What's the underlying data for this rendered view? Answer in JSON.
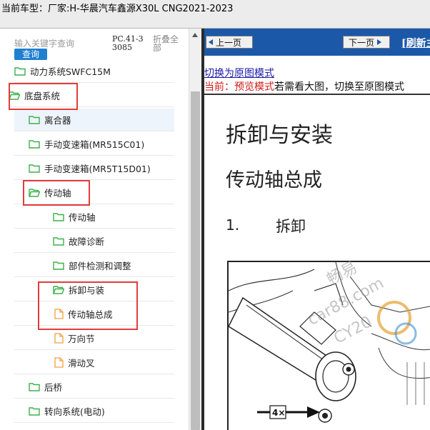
{
  "header": {
    "vehicle_label": "当前车型：厂家:H-华晨汽车鑫源X30L CNG2021-2023"
  },
  "sidebar": {
    "search_placeholder": "输入关键字查询",
    "query_label": "查询",
    "pc_code": "PC.41-33085",
    "collapse_label": "折叠全部",
    "items": [
      {
        "label": "动力系统SWFC15M",
        "icon": "folder-icon",
        "level": 0
      },
      {
        "label": "底盘系统",
        "icon": "folder-open-icon",
        "level": 0
      },
      {
        "label": "离合器",
        "icon": "folder-icon",
        "level": 1
      },
      {
        "label": "手动变速箱(MR515C01)",
        "icon": "folder-icon",
        "level": 1
      },
      {
        "label": "手动变速箱(MR5T15D01)",
        "icon": "folder-icon",
        "level": 1
      },
      {
        "label": "传动轴",
        "icon": "folder-open-icon",
        "level": 1
      },
      {
        "label": "传动轴",
        "icon": "folder-icon",
        "level": 2
      },
      {
        "label": "故障诊断",
        "icon": "folder-icon",
        "level": 2
      },
      {
        "label": "部件检测和调整",
        "icon": "folder-icon",
        "level": 2
      },
      {
        "label": "拆卸与装",
        "icon": "folder-open-icon",
        "level": 2
      },
      {
        "label": "传动轴总成",
        "icon": "document-icon",
        "level": 3
      },
      {
        "label": "万向节",
        "icon": "document-icon",
        "level": 3
      },
      {
        "label": "滑动叉",
        "icon": "document-icon",
        "level": 3
      },
      {
        "label": "后桥",
        "icon": "folder-icon",
        "level": 1
      },
      {
        "label": "转向系统(电动)",
        "icon": "folder-icon",
        "level": 1
      }
    ]
  },
  "viewer": {
    "prev_label": "上一页",
    "next_label": "下一页",
    "refresh_label": "[刷新主",
    "switch_link": "切换为原图模式",
    "mode_current": "当前：预览模式",
    "mode_hint": "若需看大图，切换至原图模式",
    "doc_title": "拆卸与安装",
    "doc_subtitle": "传动轴总成",
    "step_number": "1.",
    "step_text": "拆卸",
    "figure_callout": "4×",
    "watermarks": [
      "畅易",
      "car88.com",
      "CY20"
    ]
  },
  "colors": {
    "accent_blue": "#1c58a8",
    "query_button": "#1f7fd0",
    "highlight_red": "#e33b3b",
    "folder_green": "#3bb04a",
    "document_orange": "#f0a040",
    "mode_red": "#d11a1a",
    "link_blue": "#1a1aa8"
  }
}
